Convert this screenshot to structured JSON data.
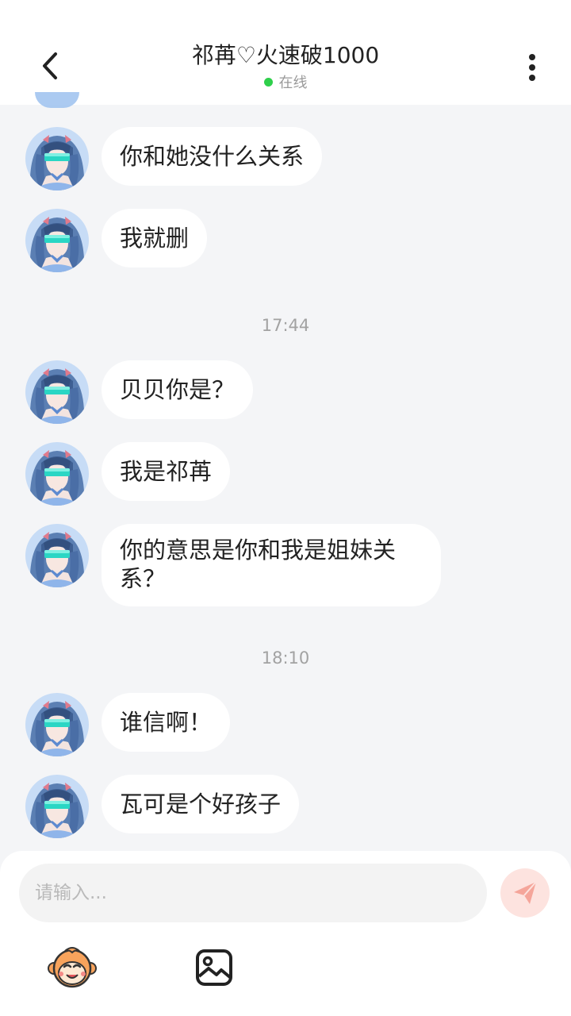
{
  "header": {
    "title": "祁苒♡火速破1000",
    "status": "在线",
    "back_icon": "chevron-left-icon",
    "more_icon": "more-vertical-icon"
  },
  "messages": [
    {
      "text": "你和她没什么关系"
    },
    {
      "text": "我就删"
    },
    {
      "time": "17:44"
    },
    {
      "text": "贝贝你是？"
    },
    {
      "text": "我是祁苒"
    },
    {
      "text": "你的意思是你和我是姐妹关系？"
    },
    {
      "time": "18:10"
    },
    {
      "text": "谁信啊！"
    },
    {
      "text": "瓦可是个好孩子"
    }
  ],
  "composer": {
    "placeholder": "请输入...",
    "send_icon": "send-icon",
    "emoji_icon": "emoji-monkey-icon",
    "image_icon": "image-icon"
  },
  "colors": {
    "background": "#f4f5f7",
    "bubble": "#ffffff",
    "online_dot": "#2fcf4b",
    "send_button": "#fde3df",
    "send_glyph": "#f5a59a"
  }
}
